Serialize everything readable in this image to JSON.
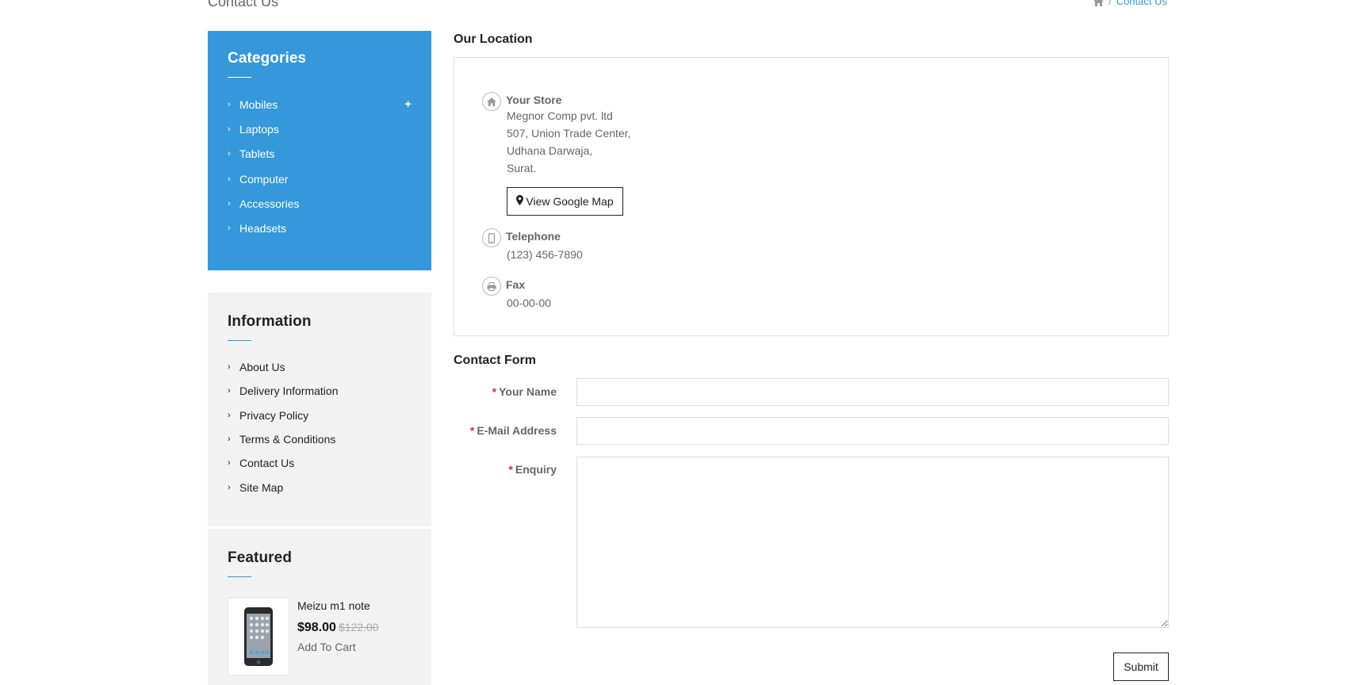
{
  "page": {
    "title": "Contact Us",
    "breadcrumb": [
      "/",
      "Contact Us"
    ]
  },
  "categories": {
    "title": "Categories",
    "items": [
      "Mobiles",
      "Laptops",
      "Tablets",
      "Computer",
      "Accessories",
      "Headsets"
    ],
    "expand_icon": "plus-icon"
  },
  "information": {
    "title": "Information",
    "items": [
      "About Us",
      "Delivery Information",
      "Privacy Policy",
      "Terms & Conditions",
      "Contact Us",
      "Site Map"
    ]
  },
  "featured": {
    "title": "Featured",
    "product": {
      "name": "Meizu m1 note",
      "price": "$98.00",
      "old_price": "$122.00",
      "cart_label": "Add To Cart"
    }
  },
  "location": {
    "title": "Our Location",
    "store_label": "Your Store",
    "address": [
      "Megnor Comp pvt. ltd",
      "507, Union Trade Center,",
      "Udhana Darwaja,",
      "Surat."
    ],
    "map_button": "View Google Map",
    "telephone_label": "Telephone",
    "telephone": "(123) 456-7890",
    "fax_label": "Fax",
    "fax": "00-00-00"
  },
  "contact_form": {
    "title": "Contact Form",
    "required_mark": "*",
    "name_label": "Your Name",
    "email_label": "E-Mail Address",
    "enquiry_label": "Enquiry",
    "name_value": "",
    "email_value": "",
    "enquiry_value": "",
    "submit_label": "Submit"
  },
  "colors": {
    "accent": "#3498db",
    "required": "#d9302b",
    "panel": "#f2f2f2"
  }
}
